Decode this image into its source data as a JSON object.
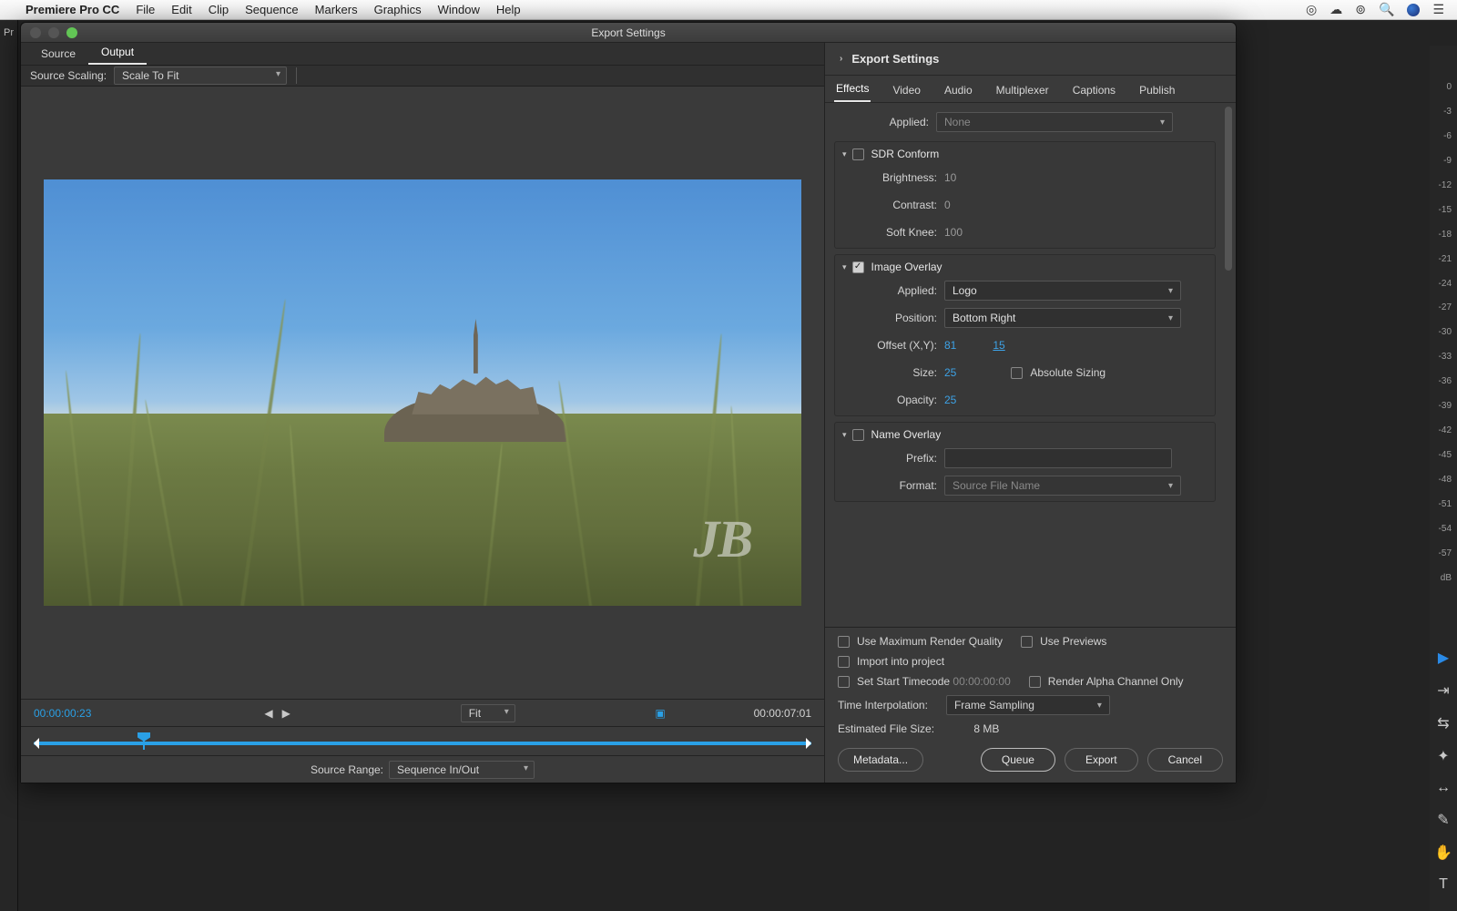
{
  "menubar": {
    "app": "Premiere Pro CC",
    "items": [
      "File",
      "Edit",
      "Clip",
      "Sequence",
      "Markers",
      "Graphics",
      "Window",
      "Help"
    ]
  },
  "audioMeter": [
    "0",
    "-3",
    "-6",
    "-9",
    "-12",
    "-15",
    "-18",
    "-21",
    "-24",
    "-27",
    "-30",
    "-33",
    "-36",
    "-39",
    "-42",
    "-45",
    "-48",
    "-51",
    "-54",
    "-57",
    "dB"
  ],
  "modal": {
    "title": "Export Settings",
    "leftTabs": {
      "source": "Source",
      "output": "Output"
    },
    "sourceScaling": {
      "label": "Source Scaling:",
      "value": "Scale To Fit"
    },
    "preview": {
      "watermark": "JB"
    },
    "playback": {
      "inTC": "00:00:00:23",
      "outTC": "00:00:07:01",
      "fit": "Fit"
    },
    "sourceRange": {
      "label": "Source Range:",
      "value": "Sequence In/Out"
    }
  },
  "right": {
    "header": "Export Settings",
    "tabs": [
      "Effects",
      "Video",
      "Audio",
      "Multiplexer",
      "Captions",
      "Publish"
    ],
    "applied": {
      "label": "Applied:",
      "value": "None"
    },
    "sdr": {
      "title": "SDR Conform",
      "brightness": {
        "label": "Brightness:",
        "value": "10"
      },
      "contrast": {
        "label": "Contrast:",
        "value": "0"
      },
      "softknee": {
        "label": "Soft Knee:",
        "value": "100"
      }
    },
    "imgOverlay": {
      "title": "Image Overlay",
      "applied": {
        "label": "Applied:",
        "value": "Logo"
      },
      "position": {
        "label": "Position:",
        "value": "Bottom Right"
      },
      "offset": {
        "label": "Offset (X,Y):",
        "x": "81",
        "y": "15"
      },
      "size": {
        "label": "Size:",
        "value": "25"
      },
      "abs": "Absolute Sizing",
      "opacity": {
        "label": "Opacity:",
        "value": "25"
      }
    },
    "nameOverlay": {
      "title": "Name Overlay",
      "prefix": {
        "label": "Prefix:"
      },
      "format": {
        "label": "Format:",
        "value": "Source File Name"
      }
    }
  },
  "footer": {
    "maxQuality": "Use Maximum Render Quality",
    "usePreviews": "Use Previews",
    "importProject": "Import into project",
    "setStartTC": "Set Start Timecode",
    "startTCval": "00:00:00:00",
    "alphaOnly": "Render Alpha Channel Only",
    "timeInterp": {
      "label": "Time Interpolation:",
      "value": "Frame Sampling"
    },
    "estSize": {
      "label": "Estimated File Size:",
      "value": "8 MB"
    },
    "buttons": {
      "metadata": "Metadata...",
      "queue": "Queue",
      "export": "Export",
      "cancel": "Cancel"
    }
  }
}
